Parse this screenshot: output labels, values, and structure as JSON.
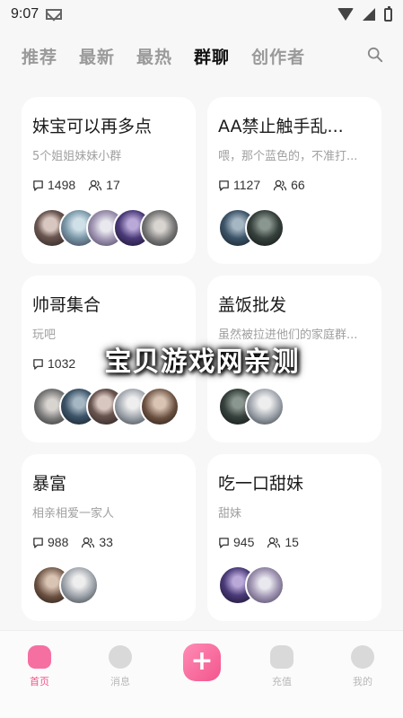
{
  "status": {
    "time": "9:07"
  },
  "tabs": [
    {
      "label": "推荐",
      "active": false
    },
    {
      "label": "最新",
      "active": false
    },
    {
      "label": "最热",
      "active": false
    },
    {
      "label": "群聊",
      "active": true
    },
    {
      "label": "创作者",
      "active": false
    }
  ],
  "groups": [
    {
      "title": "妹宝可以再多点",
      "desc": "5个姐姐妹妹小群",
      "messages": "1498",
      "members": "17"
    },
    {
      "title": "AA禁止触手乱...",
      "desc": "喂，那个蓝色的，不准打...",
      "messages": "1127",
      "members": "66"
    },
    {
      "title": "帅哥集合",
      "desc": "玩吧",
      "messages": "1032",
      "members": ""
    },
    {
      "title": "盖饭批发",
      "desc": "虽然被拉进他们的家庭群...",
      "messages": "",
      "members": ""
    },
    {
      "title": "暴富",
      "desc": "相亲相爱一家人",
      "messages": "988",
      "members": "33"
    },
    {
      "title": "吃一口甜妹",
      "desc": "甜妹",
      "messages": "945",
      "members": "15"
    }
  ],
  "watermark": "宝贝游戏网亲测",
  "nav": {
    "home": "首页",
    "messages": "消息",
    "recharge": "充值",
    "mine": "我的",
    "plus": "+"
  },
  "colors": {
    "accent": "#f2558d",
    "background": "#f7f7f7"
  }
}
